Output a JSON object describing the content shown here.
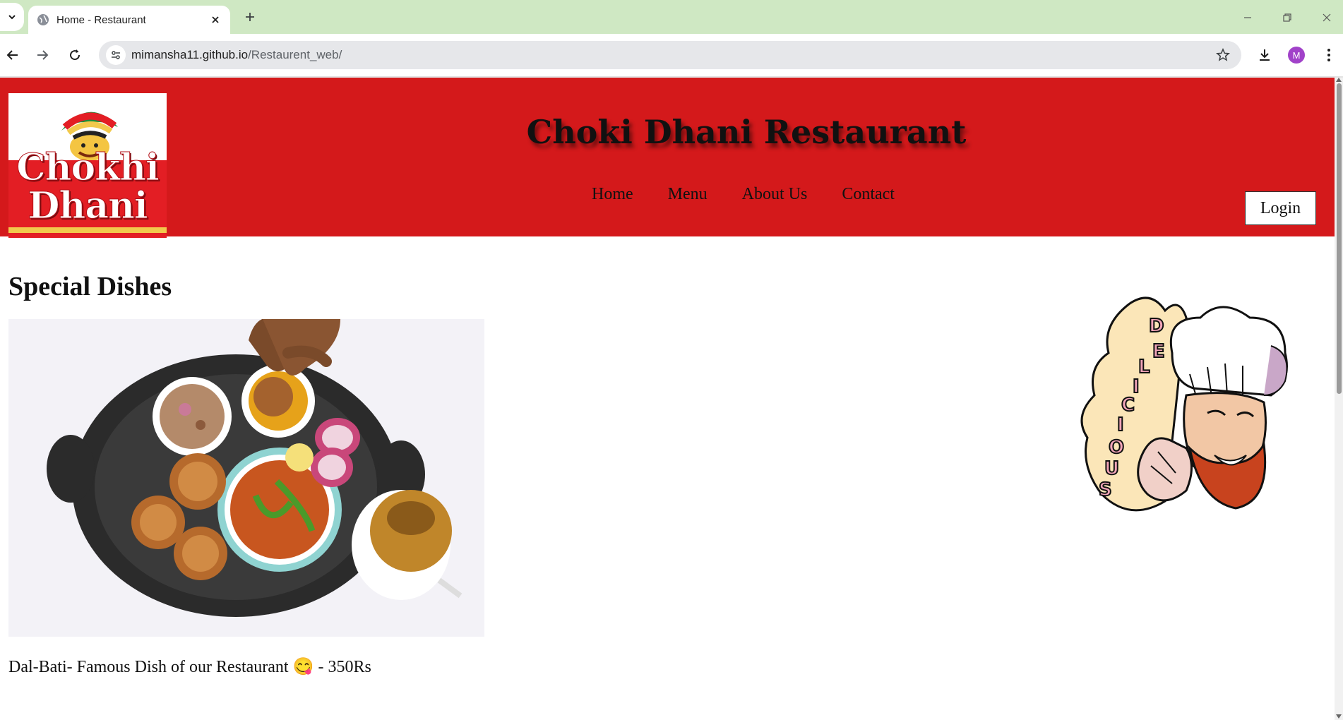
{
  "browser": {
    "tab_title": "Home - Restaurant",
    "url_host": "mimansha11.github.io",
    "url_path": "/Restaurent_web/",
    "profile_initial": "M"
  },
  "header": {
    "logo_line1": "Chokhi",
    "logo_line2": "Dhani",
    "title": "Choki Dhani Restaurant",
    "nav": [
      "Home",
      "Menu",
      "About Us",
      "Contact"
    ],
    "login_label": "Login"
  },
  "main": {
    "section_title": "Special Dishes",
    "dish_caption": "Dal-Bati- Famous Dish of our Restaurant 😋 - 350Rs",
    "sticker_letters": [
      "D",
      "E",
      "L",
      "I",
      "C",
      "I",
      "O",
      "U",
      "S"
    ]
  },
  "colors": {
    "header_red": "#d4191b",
    "tabbar_green": "#cfe8c3",
    "chef_beard": "#c8431e"
  }
}
